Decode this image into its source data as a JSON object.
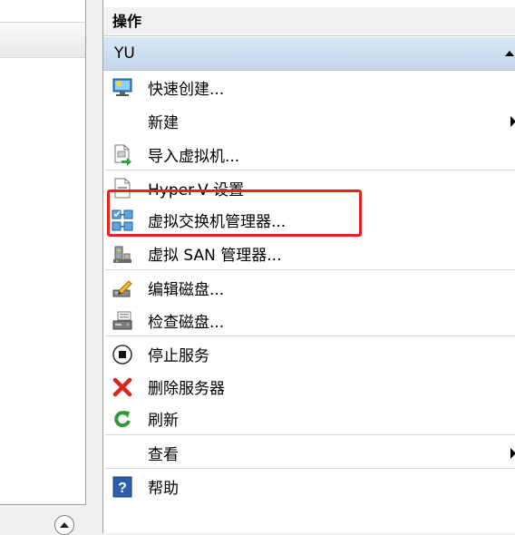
{
  "actions_pane": {
    "title": "操作",
    "group": "YU",
    "items": [
      {
        "label": "快速创建...",
        "icon": "quick-create-icon"
      },
      {
        "label": "新建",
        "icon": "none",
        "submenu": true
      },
      {
        "label": "导入虚拟机...",
        "icon": "import-vm-icon"
      },
      {
        "label": "Hyper-V 设置",
        "icon": "settings-icon"
      },
      {
        "label": "虚拟交换机管理器...",
        "icon": "virtual-switch-icon"
      },
      {
        "label": "虚拟 SAN 管理器...",
        "icon": "virtual-san-icon"
      },
      {
        "label": "编辑磁盘...",
        "icon": "edit-disk-icon"
      },
      {
        "label": "检查磁盘...",
        "icon": "inspect-disk-icon"
      },
      {
        "label": "停止服务",
        "icon": "stop-icon"
      },
      {
        "label": "删除服务器",
        "icon": "delete-icon"
      },
      {
        "label": "刷新",
        "icon": "refresh-icon"
      },
      {
        "label": "查看",
        "icon": "none",
        "submenu": true
      },
      {
        "label": "帮助",
        "icon": "help-icon"
      }
    ]
  },
  "colors": {
    "highlight": "#e8221c",
    "group_header": "#c9dbee",
    "delete": "#d9261c",
    "refresh": "#2e9a36",
    "help": "#2a5db0"
  }
}
